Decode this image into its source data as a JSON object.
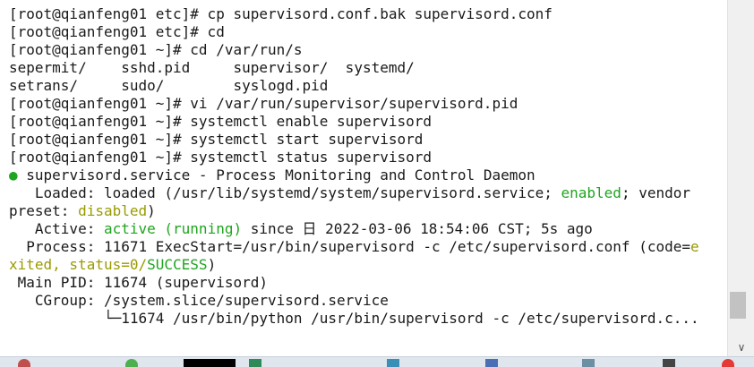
{
  "terminal": {
    "lines": {
      "l1": "[root@qianfeng01 etc]# cp supervisord.conf.bak supervisord.conf",
      "l2": "[root@qianfeng01 etc]# cd",
      "l3": "[root@qianfeng01 ~]# cd /var/run/s",
      "l4": "sepermit/    sshd.pid     supervisor/  systemd/",
      "l5": "setrans/     sudo/        syslogd.pid",
      "l6": "[root@qianfeng01 ~]# vi /var/run/supervisor/supervisord.pid",
      "l7": "[root@qianfeng01 ~]# systemctl enable supervisord",
      "l8": "[root@qianfeng01 ~]# systemctl start supervisord",
      "l9": "[root@qianfeng01 ~]# systemctl status supervisord"
    },
    "status": {
      "bullet": "●",
      "service_line": " supervisord.service - Process Monitoring and Control Daemon",
      "loaded_prefix": "   Loaded: loaded (/usr/lib/systemd/system/supervisord.service; ",
      "enabled": "enabled",
      "loaded_suffix": "; vendor",
      "preset_prefix": "preset: ",
      "disabled": "disabled",
      "preset_suffix": ")",
      "active_prefix": "   Active: ",
      "active_state": "active (running)",
      "active_suffix": " since 日 2022-03-06 18:54:06 CST; 5s ago",
      "process_prefix": "  Process: 11671 ExecStart=/usr/bin/supervisord -c /etc/supervisord.conf (code=",
      "process_e": "e",
      "exited_prefix": "xited, status=0/",
      "success": "SUCCESS",
      "exited_suffix": ")",
      "main_pid": " Main PID: 11674 (supervisord)",
      "cgroup": "   CGroup: /system.slice/supervisord.service",
      "cgroup_child": "           └─11674 /usr/bin/python /usr/bin/supervisord -c /etc/supervisord.c..."
    }
  },
  "scrollbar": {
    "up_icon": "chevron-up-icon",
    "down_icon": "chevron-down-icon",
    "down_glyph": "∨"
  },
  "colors": {
    "green": "#1fa51f",
    "olive": "#9a9a00"
  }
}
